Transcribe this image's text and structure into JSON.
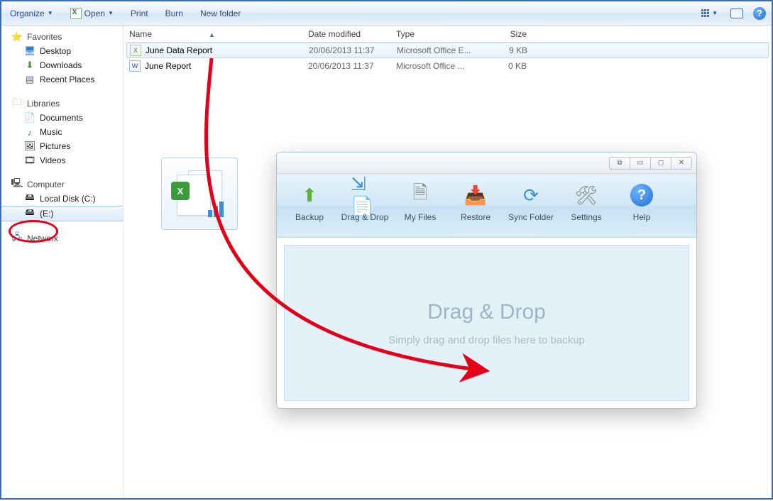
{
  "toolbar": {
    "organize": "Organize",
    "open": "Open",
    "print": "Print",
    "burn": "Burn",
    "newfolder": "New folder"
  },
  "sidebar": {
    "favorites": {
      "label": "Favorites",
      "items": [
        "Desktop",
        "Downloads",
        "Recent Places"
      ]
    },
    "libraries": {
      "label": "Libraries",
      "items": [
        "Documents",
        "Music",
        "Pictures",
        "Videos"
      ]
    },
    "computer": {
      "label": "Computer",
      "items": [
        "Local Disk (C:)",
        "(E:)"
      ]
    },
    "network": {
      "label": "Network"
    }
  },
  "columns": {
    "name": "Name",
    "date": "Date modified",
    "type": "Type",
    "size": "Size"
  },
  "files": [
    {
      "name": "June Data Report",
      "date": "20/06/2013 11:37",
      "type": "Microsoft Office E...",
      "size": "9 KB",
      "kind": "xl",
      "selected": true
    },
    {
      "name": "June Report",
      "date": "20/06/2013 11:37",
      "type": "Microsoft Office ...",
      "size": "0 KB",
      "kind": "wd",
      "selected": false
    }
  ],
  "app": {
    "buttons": [
      "Backup",
      "Drag & Drop",
      "My Files",
      "Restore",
      "Sync Folder",
      "Settings",
      "Help"
    ],
    "drop_title": "Drag & Drop",
    "drop_sub": "Simply drag and drop files here to backup"
  }
}
